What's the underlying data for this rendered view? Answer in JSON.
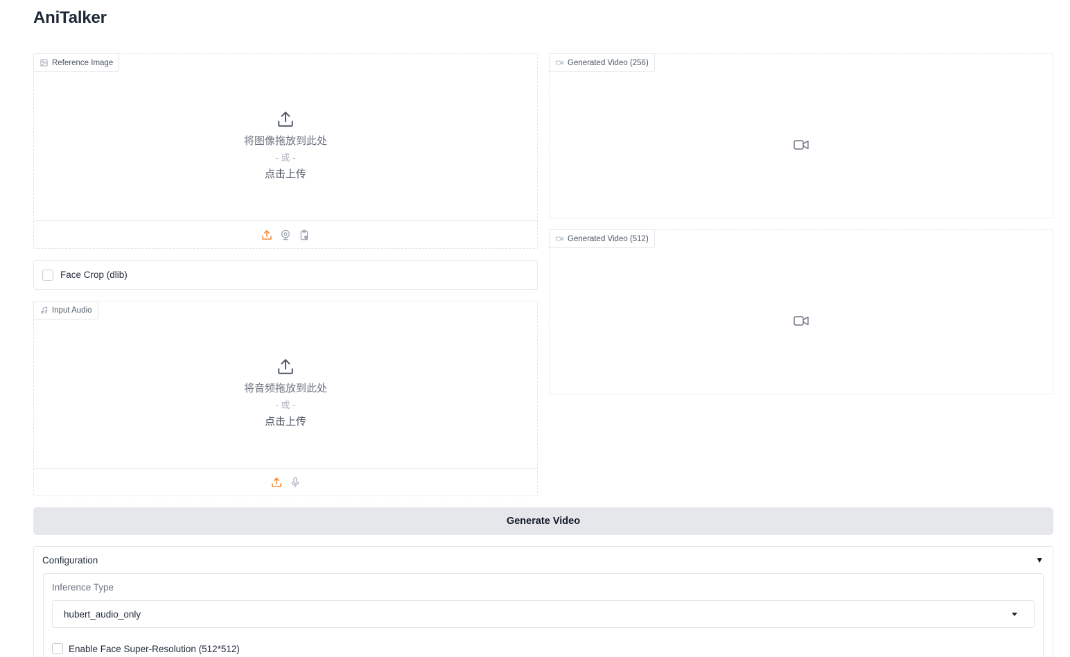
{
  "app": {
    "title": "AniTalker"
  },
  "reference_image": {
    "label": "Reference Image",
    "drop_text": "将图像拖放到此处",
    "or_text": "- 或 -",
    "click_text": "点击上传"
  },
  "face_crop": {
    "label": "Face Crop (dlib)",
    "checked": false
  },
  "input_audio": {
    "label": "Input Audio",
    "drop_text": "将音频拖放到此处",
    "or_text": "- 或 -",
    "click_text": "点击上传"
  },
  "video_256": {
    "label": "Generated Video (256)"
  },
  "video_512": {
    "label": "Generated Video (512)"
  },
  "generate_button": {
    "label": "Generate Video"
  },
  "configuration": {
    "header": "Configuration",
    "caret": "▼",
    "inference_type_label": "Inference Type",
    "inference_type_value": "hubert_audio_only",
    "super_resolution_label": "Enable Face Super-Resolution (512*512)",
    "super_resolution_checked": false
  },
  "colors": {
    "accent": "#f97316",
    "icon_gray": "#6b7280",
    "button_bg": "#e5e7eb"
  }
}
